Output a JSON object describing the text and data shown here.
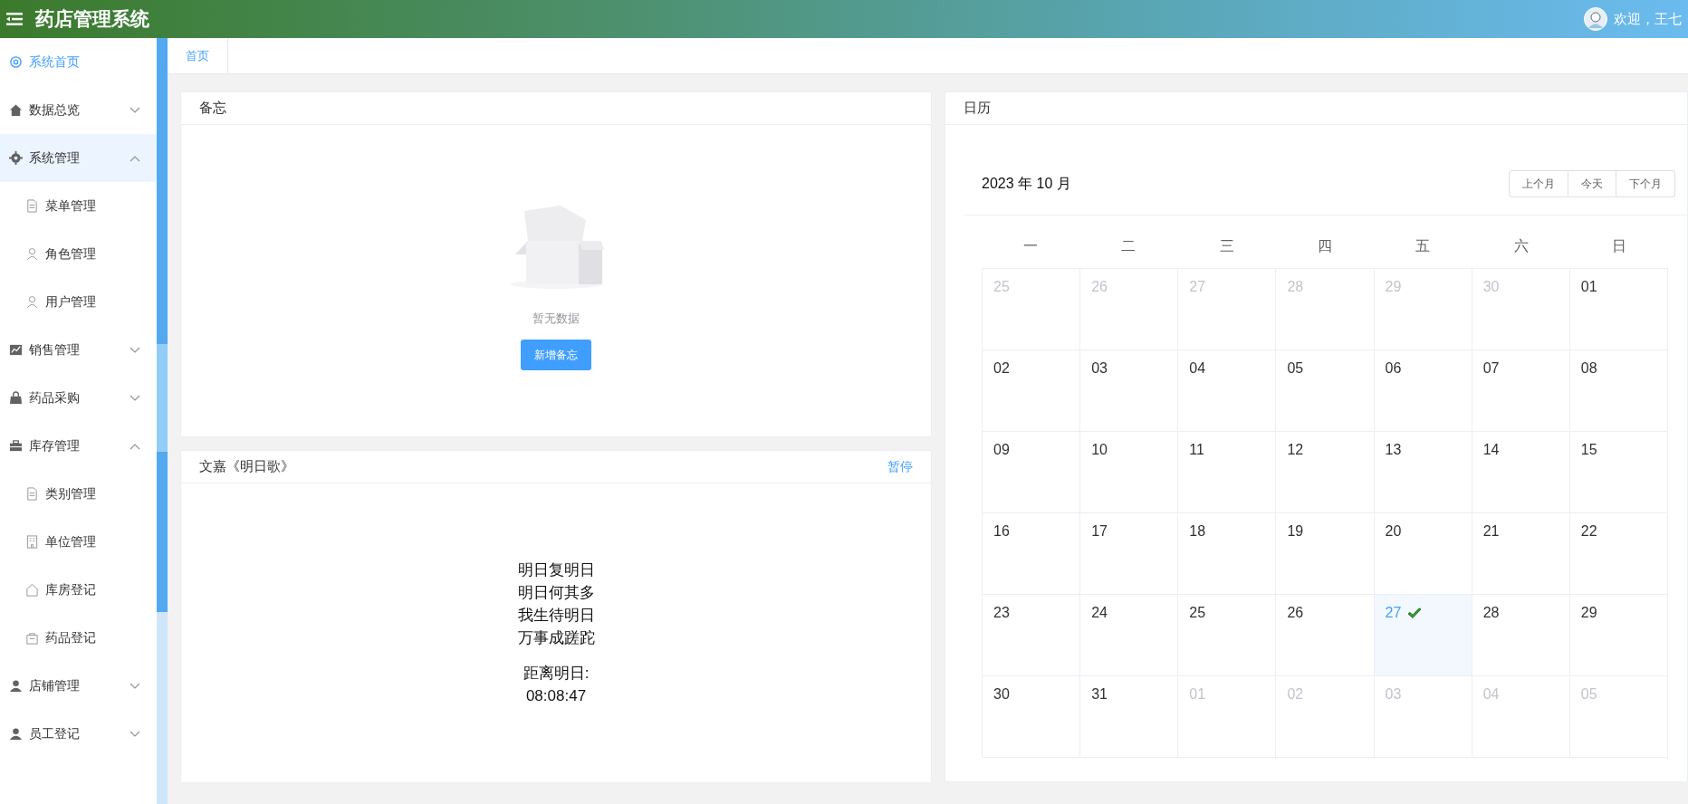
{
  "header": {
    "title": "药店管理系统",
    "welcome": "欢迎，王七"
  },
  "sidebar": {
    "items": [
      {
        "label": "系统首页",
        "kind": "link",
        "selected": true,
        "hovered": false
      },
      {
        "label": "数据总览",
        "kind": "group",
        "selected": false,
        "hovered": false,
        "expanded": false
      },
      {
        "label": "系统管理",
        "kind": "group",
        "selected": false,
        "hovered": true,
        "expanded": true,
        "children": [
          {
            "label": "菜单管理",
            "selected": false
          },
          {
            "label": "角色管理",
            "selected": false
          },
          {
            "label": "用户管理",
            "selected": false
          }
        ]
      },
      {
        "label": "销售管理",
        "kind": "group",
        "selected": false,
        "hovered": false,
        "expanded": false
      },
      {
        "label": "药品采购",
        "kind": "group",
        "selected": false,
        "hovered": false,
        "expanded": false
      },
      {
        "label": "库存管理",
        "kind": "group",
        "selected": false,
        "hovered": false,
        "expanded": true,
        "children": [
          {
            "label": "类别管理",
            "selected": false
          },
          {
            "label": "单位管理",
            "selected": false
          },
          {
            "label": "库房登记",
            "selected": false
          },
          {
            "label": "药品登记",
            "selected": false
          }
        ]
      },
      {
        "label": "店铺管理",
        "kind": "group",
        "selected": false,
        "hovered": false,
        "expanded": false
      },
      {
        "label": "员工登记",
        "kind": "group",
        "selected": false,
        "hovered": false,
        "expanded": false
      }
    ]
  },
  "tabs": [
    {
      "label": "首页",
      "selected": true
    }
  ],
  "memo": {
    "title": "备忘",
    "empty_text": "暂无数据",
    "button": "新增备忘"
  },
  "poem": {
    "title": "文嘉《明日歌》",
    "action": "暂停",
    "lines": [
      "明日复明日",
      "明日何其多",
      "我生待明日",
      "万事成蹉跎"
    ],
    "countdown_label": "距离明日:",
    "countdown": "08:08:47"
  },
  "calendar": {
    "title": "日历",
    "month": "2023 年 10 月",
    "buttons": [
      "上个月",
      "今天",
      "下个月"
    ],
    "weekdays": [
      "一",
      "二",
      "三",
      "四",
      "五",
      "六",
      "日"
    ],
    "weeks": [
      [
        {
          "day": "25",
          "in_month": false,
          "selected": false,
          "marked": false
        },
        {
          "day": "26",
          "in_month": false,
          "selected": false,
          "marked": false
        },
        {
          "day": "27",
          "in_month": false,
          "selected": false,
          "marked": false
        },
        {
          "day": "28",
          "in_month": false,
          "selected": false,
          "marked": false
        },
        {
          "day": "29",
          "in_month": false,
          "selected": false,
          "marked": false
        },
        {
          "day": "30",
          "in_month": false,
          "selected": false,
          "marked": false
        },
        {
          "day": "01",
          "in_month": true,
          "selected": false,
          "marked": false
        }
      ],
      [
        {
          "day": "02",
          "in_month": true,
          "selected": false,
          "marked": false
        },
        {
          "day": "03",
          "in_month": true,
          "selected": false,
          "marked": false
        },
        {
          "day": "04",
          "in_month": true,
          "selected": false,
          "marked": false
        },
        {
          "day": "05",
          "in_month": true,
          "selected": false,
          "marked": false
        },
        {
          "day": "06",
          "in_month": true,
          "selected": false,
          "marked": false
        },
        {
          "day": "07",
          "in_month": true,
          "selected": false,
          "marked": false
        },
        {
          "day": "08",
          "in_month": true,
          "selected": false,
          "marked": false
        }
      ],
      [
        {
          "day": "09",
          "in_month": true,
          "selected": false,
          "marked": false
        },
        {
          "day": "10",
          "in_month": true,
          "selected": false,
          "marked": false
        },
        {
          "day": "11",
          "in_month": true,
          "selected": false,
          "marked": false
        },
        {
          "day": "12",
          "in_month": true,
          "selected": false,
          "marked": false
        },
        {
          "day": "13",
          "in_month": true,
          "selected": false,
          "marked": false
        },
        {
          "day": "14",
          "in_month": true,
          "selected": false,
          "marked": false
        },
        {
          "day": "15",
          "in_month": true,
          "selected": false,
          "marked": false
        }
      ],
      [
        {
          "day": "16",
          "in_month": true,
          "selected": false,
          "marked": false
        },
        {
          "day": "17",
          "in_month": true,
          "selected": false,
          "marked": false
        },
        {
          "day": "18",
          "in_month": true,
          "selected": false,
          "marked": false
        },
        {
          "day": "19",
          "in_month": true,
          "selected": false,
          "marked": false
        },
        {
          "day": "20",
          "in_month": true,
          "selected": false,
          "marked": false
        },
        {
          "day": "21",
          "in_month": true,
          "selected": false,
          "marked": false
        },
        {
          "day": "22",
          "in_month": true,
          "selected": false,
          "marked": false
        }
      ],
      [
        {
          "day": "23",
          "in_month": true,
          "selected": false,
          "marked": false
        },
        {
          "day": "24",
          "in_month": true,
          "selected": false,
          "marked": false
        },
        {
          "day": "25",
          "in_month": true,
          "selected": false,
          "marked": false
        },
        {
          "day": "26",
          "in_month": true,
          "selected": false,
          "marked": false
        },
        {
          "day": "27",
          "in_month": true,
          "selected": true,
          "marked": true
        },
        {
          "day": "28",
          "in_month": true,
          "selected": false,
          "marked": false
        },
        {
          "day": "29",
          "in_month": true,
          "selected": false,
          "marked": false
        }
      ],
      [
        {
          "day": "30",
          "in_month": true,
          "selected": false,
          "marked": false
        },
        {
          "day": "31",
          "in_month": true,
          "selected": false,
          "marked": false
        },
        {
          "day": "01",
          "in_month": false,
          "selected": false,
          "marked": false
        },
        {
          "day": "02",
          "in_month": false,
          "selected": false,
          "marked": false
        },
        {
          "day": "03",
          "in_month": false,
          "selected": false,
          "marked": false
        },
        {
          "day": "04",
          "in_month": false,
          "selected": false,
          "marked": false
        },
        {
          "day": "05",
          "in_month": false,
          "selected": false,
          "marked": false
        }
      ]
    ]
  }
}
